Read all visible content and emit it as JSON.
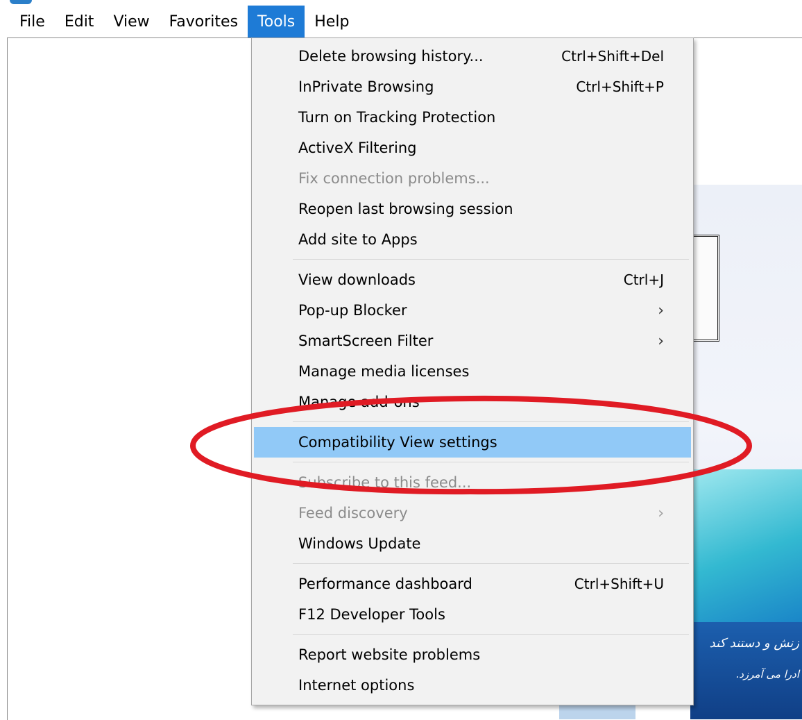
{
  "menubar": {
    "items": [
      "File",
      "Edit",
      "View",
      "Favorites",
      "Tools",
      "Help"
    ],
    "active_index": 4
  },
  "tools_menu": {
    "items": [
      {
        "label": "Delete browsing history...",
        "shortcut": "Ctrl+Shift+Del",
        "enabled": true
      },
      {
        "label": "InPrivate Browsing",
        "shortcut": "Ctrl+Shift+P",
        "enabled": true
      },
      {
        "label": "Turn on Tracking Protection",
        "shortcut": "",
        "enabled": true
      },
      {
        "label": "ActiveX Filtering",
        "shortcut": "",
        "enabled": true
      },
      {
        "label": "Fix connection problems...",
        "shortcut": "",
        "enabled": false
      },
      {
        "label": "Reopen last browsing session",
        "shortcut": "",
        "enabled": true
      },
      {
        "label": "Add site to Apps",
        "shortcut": "",
        "enabled": true
      },
      {
        "label": "View downloads",
        "shortcut": "Ctrl+J",
        "enabled": true
      },
      {
        "label": "Pop-up Blocker",
        "shortcut": "",
        "submenu": true,
        "enabled": true
      },
      {
        "label": "SmartScreen Filter",
        "shortcut": "",
        "submenu": true,
        "enabled": true
      },
      {
        "label": "Manage media licenses",
        "shortcut": "",
        "enabled": true
      },
      {
        "label": "Manage add-ons",
        "shortcut": "",
        "enabled": true
      },
      {
        "label": "Compatibility View settings",
        "shortcut": "",
        "enabled": true,
        "highlighted": true
      },
      {
        "label": "Subscribe to this feed...",
        "shortcut": "",
        "enabled": false
      },
      {
        "label": "Feed discovery",
        "shortcut": "",
        "submenu": true,
        "enabled": false
      },
      {
        "label": "Windows Update",
        "shortcut": "",
        "enabled": true
      },
      {
        "label": "Performance dashboard",
        "shortcut": "Ctrl+Shift+U",
        "enabled": true
      },
      {
        "label": "F12 Developer Tools",
        "shortcut": "",
        "enabled": true
      },
      {
        "label": "Report website problems",
        "shortcut": "",
        "enabled": true
      },
      {
        "label": "Internet options",
        "shortcut": "",
        "enabled": true
      }
    ],
    "submenu_glyph": "›"
  },
  "background_page": {
    "arabic_text_1": "زنش و دستند کند",
    "arabic_text_2": "ادرا می آمرزد."
  },
  "colors": {
    "menubar_active": "#1e7bd6",
    "menu_highlight": "#91c9f7",
    "annotation_ellipse": "#e01b24"
  },
  "icons": {
    "submenu_arrow": "chevron-right-icon"
  }
}
